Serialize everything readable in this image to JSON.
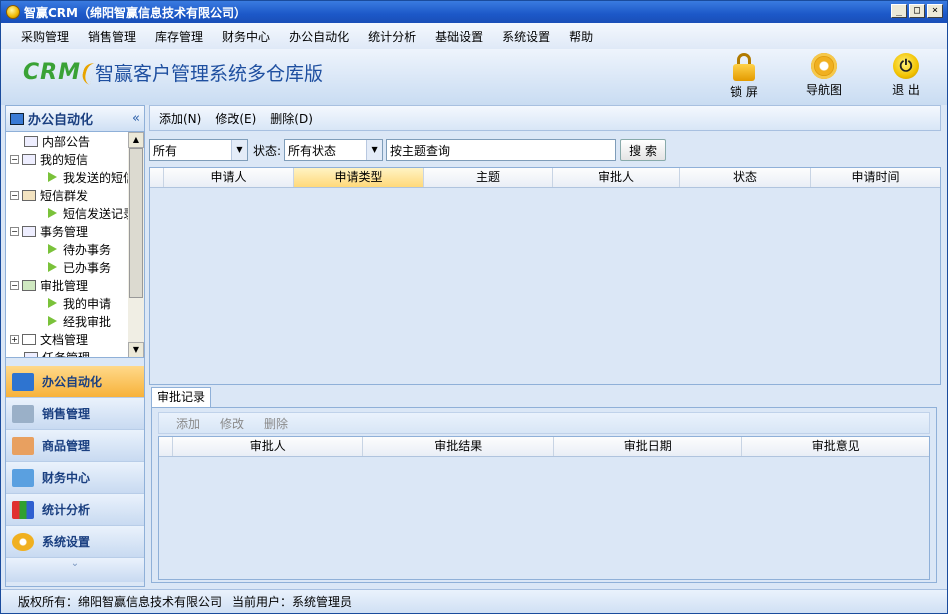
{
  "window": {
    "title": "智赢CRM（绵阳智赢信息技术有限公司）",
    "min": "_",
    "max": "□",
    "close": "×"
  },
  "menu": [
    "采购管理",
    "销售管理",
    "库存管理",
    "财务中心",
    "办公自动化",
    "统计分析",
    "基础设置",
    "系统设置",
    "帮助"
  ],
  "header": {
    "logo": "CRM",
    "product": "智赢客户管理系统多仓库版",
    "lock": "锁 屏",
    "nav": "导航图",
    "exit": "退 出"
  },
  "left": {
    "title": "办公自动化",
    "collapse": "«",
    "tree": [
      "内部公告",
      "我的短信",
      "我发送的短信",
      "短信群发",
      "短信发送记录",
      "事务管理",
      "待办事务",
      "已办事务",
      "审批管理",
      "我的申请",
      "经我审批",
      "文档管理",
      "任务管理"
    ],
    "nav": [
      "办公自动化",
      "销售管理",
      "商品管理",
      "财务中心",
      "统计分析",
      "系统设置"
    ],
    "bottom": "⌄"
  },
  "toolbar": {
    "add": "添加(N)",
    "edit": "修改(E)",
    "delete": "删除(D)"
  },
  "filter": {
    "type": "所有",
    "status_label": "状态:",
    "status": "所有状态",
    "query": "按主题查询",
    "search": "搜 索"
  },
  "grid": {
    "columns": [
      "申请人",
      "申请类型",
      "主题",
      "审批人",
      "状态",
      "申请时间"
    ]
  },
  "sub": {
    "tab": "审批记录",
    "add": "添加",
    "edit": "修改",
    "delete": "删除",
    "columns": [
      "审批人",
      "审批结果",
      "审批日期",
      "审批意见"
    ]
  },
  "status": {
    "copyright": "版权所有：绵阳智赢信息技术有限公司",
    "user": "当前用户：系统管理员"
  },
  "colors": {
    "accent": "#1c58c8",
    "active_nav": "#f7b23a"
  }
}
